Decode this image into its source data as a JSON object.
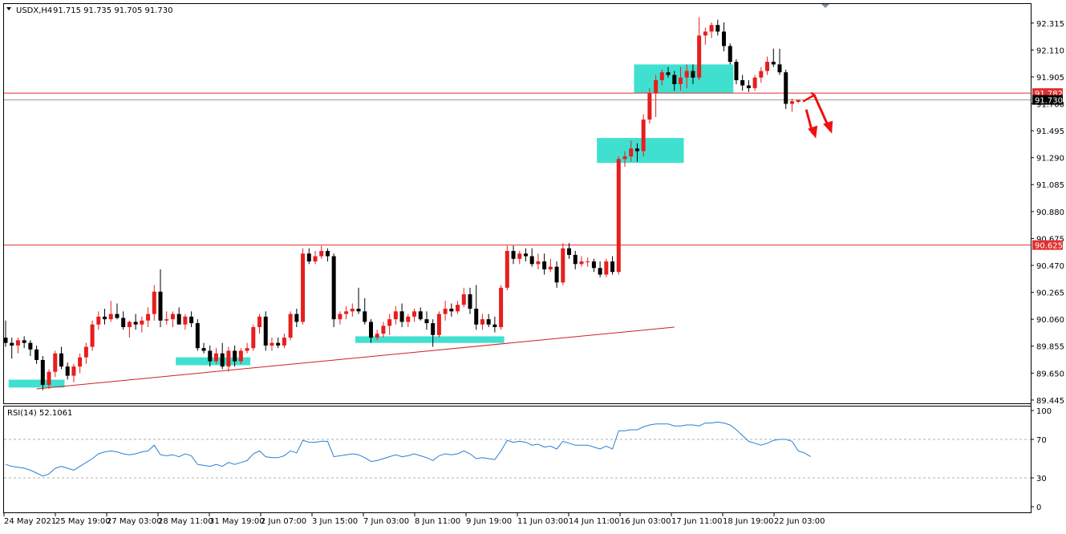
{
  "header": {
    "symbol_label": "USDX,H4",
    "ohlc_label": "91.715 91.735 91.705 91.730"
  },
  "rsi": {
    "label": "RSI(14) 52.1061",
    "levels": [
      70,
      30
    ],
    "ticks": [
      "100",
      "70",
      "30",
      "0"
    ],
    "color": "#2a7fd4",
    "level_color": "#b0b0b0"
  },
  "price_axis": {
    "ticks": [
      "92.315",
      "92.110",
      "91.905",
      "91.700",
      "91.495",
      "91.290",
      "91.085",
      "90.880",
      "90.675",
      "90.470",
      "90.265",
      "90.060",
      "89.855",
      "89.650",
      "89.445"
    ]
  },
  "time_axis": {
    "labels": [
      "24 May 2021",
      "25 May 19:00",
      "27 May 03:00",
      "28 May 11:00",
      "31 May 19:00",
      "2 Jun 07:00",
      "3 Jun 15:00",
      "7 Jun 03:00",
      "8 Jun 11:00",
      "9 Jun 19:00",
      "11 Jun 03:00",
      "14 Jun 11:00",
      "16 Jun 03:00",
      "17 Jun 11:00",
      "18 Jun 19:00",
      "22 Jun 03:00"
    ]
  },
  "levels": [
    {
      "price": 91.782,
      "label": "91.782",
      "color": "#e03030"
    },
    {
      "price": 90.625,
      "label": "90.625",
      "color": "#e03030"
    }
  ],
  "current_price": {
    "price": 91.73,
    "label": "91.730",
    "color": "#000000"
  },
  "colors": {
    "bull": "#e61e1e",
    "bear": "#000000",
    "zone": "#40e0d0",
    "trendline": "#cc2222",
    "arrow": "#ee1111"
  },
  "chart_data": {
    "type": "candlestick",
    "symbol": "USDX",
    "timeframe": "H4",
    "ylim": [
      89.42,
      92.46
    ],
    "rsi_ylim": [
      0,
      100
    ],
    "candles": [
      {
        "o": 89.92,
        "h": 90.05,
        "l": 89.85,
        "c": 89.88
      },
      {
        "o": 89.88,
        "h": 89.92,
        "l": 89.76,
        "c": 89.86
      },
      {
        "o": 89.86,
        "h": 89.92,
        "l": 89.8,
        "c": 89.9
      },
      {
        "o": 89.9,
        "h": 89.93,
        "l": 89.84,
        "c": 89.88
      },
      {
        "o": 89.88,
        "h": 89.9,
        "l": 89.78,
        "c": 89.83
      },
      {
        "o": 89.83,
        "h": 89.86,
        "l": 89.72,
        "c": 89.75
      },
      {
        "o": 89.75,
        "h": 89.78,
        "l": 89.52,
        "c": 89.56
      },
      {
        "o": 89.56,
        "h": 89.68,
        "l": 89.53,
        "c": 89.66
      },
      {
        "o": 89.66,
        "h": 89.82,
        "l": 89.62,
        "c": 89.8
      },
      {
        "o": 89.8,
        "h": 89.85,
        "l": 89.68,
        "c": 89.7
      },
      {
        "o": 89.7,
        "h": 89.73,
        "l": 89.6,
        "c": 89.63
      },
      {
        "o": 89.63,
        "h": 89.72,
        "l": 89.58,
        "c": 89.7
      },
      {
        "o": 89.7,
        "h": 89.8,
        "l": 89.65,
        "c": 89.77
      },
      {
        "o": 89.77,
        "h": 89.88,
        "l": 89.72,
        "c": 89.85
      },
      {
        "o": 89.85,
        "h": 90.05,
        "l": 89.82,
        "c": 90.02
      },
      {
        "o": 90.02,
        "h": 90.12,
        "l": 89.98,
        "c": 90.08
      },
      {
        "o": 90.08,
        "h": 90.14,
        "l": 90.02,
        "c": 90.06
      },
      {
        "o": 90.06,
        "h": 90.2,
        "l": 90.04,
        "c": 90.1
      },
      {
        "o": 90.1,
        "h": 90.18,
        "l": 90.06,
        "c": 90.07
      },
      {
        "o": 90.07,
        "h": 90.12,
        "l": 89.98,
        "c": 90.0
      },
      {
        "o": 90.0,
        "h": 90.05,
        "l": 89.92,
        "c": 90.04
      },
      {
        "o": 90.04,
        "h": 90.1,
        "l": 89.98,
        "c": 90.02
      },
      {
        "o": 90.02,
        "h": 90.08,
        "l": 89.96,
        "c": 90.05
      },
      {
        "o": 90.05,
        "h": 90.15,
        "l": 90.0,
        "c": 90.1
      },
      {
        "o": 90.1,
        "h": 90.32,
        "l": 90.05,
        "c": 90.27
      },
      {
        "o": 90.27,
        "h": 90.44,
        "l": 90.0,
        "c": 90.05
      },
      {
        "o": 90.05,
        "h": 90.12,
        "l": 90.02,
        "c": 90.06
      },
      {
        "o": 90.06,
        "h": 90.12,
        "l": 90.0,
        "c": 90.1
      },
      {
        "o": 90.1,
        "h": 90.15,
        "l": 90.04,
        "c": 90.02
      },
      {
        "o": 90.02,
        "h": 90.1,
        "l": 89.98,
        "c": 90.08
      },
      {
        "o": 90.08,
        "h": 90.12,
        "l": 90.0,
        "c": 90.03
      },
      {
        "o": 90.03,
        "h": 90.06,
        "l": 89.82,
        "c": 89.84
      },
      {
        "o": 89.84,
        "h": 89.88,
        "l": 89.8,
        "c": 89.82
      },
      {
        "o": 89.82,
        "h": 89.86,
        "l": 89.7,
        "c": 89.74
      },
      {
        "o": 89.74,
        "h": 89.84,
        "l": 89.72,
        "c": 89.8
      },
      {
        "o": 89.8,
        "h": 89.88,
        "l": 89.68,
        "c": 89.7
      },
      {
        "o": 89.7,
        "h": 89.85,
        "l": 89.66,
        "c": 89.82
      },
      {
        "o": 89.82,
        "h": 89.86,
        "l": 89.7,
        "c": 89.74
      },
      {
        "o": 89.74,
        "h": 89.84,
        "l": 89.72,
        "c": 89.82
      },
      {
        "o": 89.82,
        "h": 89.88,
        "l": 89.8,
        "c": 89.84
      },
      {
        "o": 89.84,
        "h": 90.02,
        "l": 89.82,
        "c": 90.0
      },
      {
        "o": 90.0,
        "h": 90.1,
        "l": 89.95,
        "c": 90.08
      },
      {
        "o": 90.08,
        "h": 90.12,
        "l": 89.82,
        "c": 89.86
      },
      {
        "o": 89.86,
        "h": 89.92,
        "l": 89.82,
        "c": 89.88
      },
      {
        "o": 89.88,
        "h": 89.92,
        "l": 89.84,
        "c": 89.86
      },
      {
        "o": 89.86,
        "h": 89.95,
        "l": 89.84,
        "c": 89.92
      },
      {
        "o": 89.92,
        "h": 90.12,
        "l": 89.9,
        "c": 90.1
      },
      {
        "o": 90.1,
        "h": 90.14,
        "l": 90.0,
        "c": 90.04
      },
      {
        "o": 90.04,
        "h": 90.6,
        "l": 90.02,
        "c": 90.56
      },
      {
        "o": 90.56,
        "h": 90.6,
        "l": 90.48,
        "c": 90.5
      },
      {
        "o": 90.5,
        "h": 90.58,
        "l": 90.48,
        "c": 90.54
      },
      {
        "o": 90.54,
        "h": 90.62,
        "l": 90.52,
        "c": 90.58
      },
      {
        "o": 90.58,
        "h": 90.6,
        "l": 90.5,
        "c": 90.54
      },
      {
        "o": 90.54,
        "h": 90.56,
        "l": 90.0,
        "c": 90.06
      },
      {
        "o": 90.06,
        "h": 90.12,
        "l": 90.02,
        "c": 90.1
      },
      {
        "o": 90.1,
        "h": 90.16,
        "l": 90.06,
        "c": 90.12
      },
      {
        "o": 90.12,
        "h": 90.18,
        "l": 90.08,
        "c": 90.14
      },
      {
        "o": 90.14,
        "h": 90.3,
        "l": 90.1,
        "c": 90.12
      },
      {
        "o": 90.12,
        "h": 90.22,
        "l": 90.02,
        "c": 90.04
      },
      {
        "o": 90.04,
        "h": 90.06,
        "l": 89.88,
        "c": 89.92
      },
      {
        "o": 89.92,
        "h": 89.98,
        "l": 89.9,
        "c": 89.95
      },
      {
        "o": 89.95,
        "h": 90.04,
        "l": 89.92,
        "c": 90.01
      },
      {
        "o": 90.01,
        "h": 90.1,
        "l": 89.94,
        "c": 90.06
      },
      {
        "o": 90.06,
        "h": 90.16,
        "l": 90.02,
        "c": 90.12
      },
      {
        "o": 90.12,
        "h": 90.18,
        "l": 90.0,
        "c": 90.04
      },
      {
        "o": 90.04,
        "h": 90.1,
        "l": 90.0,
        "c": 90.08
      },
      {
        "o": 90.08,
        "h": 90.14,
        "l": 90.04,
        "c": 90.12
      },
      {
        "o": 90.12,
        "h": 90.15,
        "l": 90.05,
        "c": 90.06
      },
      {
        "o": 90.06,
        "h": 90.12,
        "l": 89.98,
        "c": 90.03
      },
      {
        "o": 90.03,
        "h": 90.06,
        "l": 89.85,
        "c": 89.94
      },
      {
        "o": 89.94,
        "h": 90.12,
        "l": 89.92,
        "c": 90.1
      },
      {
        "o": 90.1,
        "h": 90.2,
        "l": 90.05,
        "c": 90.14
      },
      {
        "o": 90.14,
        "h": 90.18,
        "l": 90.08,
        "c": 90.12
      },
      {
        "o": 90.12,
        "h": 90.2,
        "l": 90.1,
        "c": 90.17
      },
      {
        "o": 90.17,
        "h": 90.3,
        "l": 90.15,
        "c": 90.25
      },
      {
        "o": 90.25,
        "h": 90.3,
        "l": 90.1,
        "c": 90.14
      },
      {
        "o": 90.14,
        "h": 90.32,
        "l": 89.98,
        "c": 90.02
      },
      {
        "o": 90.02,
        "h": 90.1,
        "l": 89.98,
        "c": 90.06
      },
      {
        "o": 90.06,
        "h": 90.1,
        "l": 90.0,
        "c": 90.02
      },
      {
        "o": 90.02,
        "h": 90.08,
        "l": 89.96,
        "c": 90.0
      },
      {
        "o": 90.0,
        "h": 90.32,
        "l": 89.98,
        "c": 90.3
      },
      {
        "o": 90.3,
        "h": 90.62,
        "l": 90.28,
        "c": 90.58
      },
      {
        "o": 90.58,
        "h": 90.62,
        "l": 90.48,
        "c": 90.52
      },
      {
        "o": 90.52,
        "h": 90.58,
        "l": 90.48,
        "c": 90.56
      },
      {
        "o": 90.56,
        "h": 90.6,
        "l": 90.5,
        "c": 90.54
      },
      {
        "o": 90.54,
        "h": 90.6,
        "l": 90.46,
        "c": 90.48
      },
      {
        "o": 90.48,
        "h": 90.56,
        "l": 90.44,
        "c": 90.5
      },
      {
        "o": 90.5,
        "h": 90.56,
        "l": 90.4,
        "c": 90.44
      },
      {
        "o": 90.44,
        "h": 90.52,
        "l": 90.42,
        "c": 90.46
      },
      {
        "o": 90.46,
        "h": 90.5,
        "l": 90.3,
        "c": 90.34
      },
      {
        "o": 90.34,
        "h": 90.64,
        "l": 90.32,
        "c": 90.6
      },
      {
        "o": 90.6,
        "h": 90.64,
        "l": 90.52,
        "c": 90.55
      },
      {
        "o": 90.55,
        "h": 90.58,
        "l": 90.44,
        "c": 90.48
      },
      {
        "o": 90.48,
        "h": 90.54,
        "l": 90.46,
        "c": 90.5
      },
      {
        "o": 90.5,
        "h": 90.53,
        "l": 90.46,
        "c": 90.5
      },
      {
        "o": 90.5,
        "h": 90.52,
        "l": 90.42,
        "c": 90.45
      },
      {
        "o": 90.45,
        "h": 90.5,
        "l": 90.38,
        "c": 90.4
      },
      {
        "o": 90.4,
        "h": 90.52,
        "l": 90.38,
        "c": 90.5
      },
      {
        "o": 90.5,
        "h": 90.54,
        "l": 90.4,
        "c": 90.42
      },
      {
        "o": 90.42,
        "h": 91.3,
        "l": 90.4,
        "c": 91.28
      },
      {
        "o": 91.28,
        "h": 91.34,
        "l": 91.22,
        "c": 91.3
      },
      {
        "o": 91.3,
        "h": 91.42,
        "l": 91.26,
        "c": 91.36
      },
      {
        "o": 91.36,
        "h": 91.4,
        "l": 91.26,
        "c": 91.34
      },
      {
        "o": 91.34,
        "h": 91.62,
        "l": 91.3,
        "c": 91.58
      },
      {
        "o": 91.58,
        "h": 91.82,
        "l": 91.55,
        "c": 91.78
      },
      {
        "o": 91.78,
        "h": 91.92,
        "l": 91.6,
        "c": 91.88
      },
      {
        "o": 91.88,
        "h": 91.96,
        "l": 91.84,
        "c": 91.94
      },
      {
        "o": 91.94,
        "h": 91.98,
        "l": 91.9,
        "c": 91.92
      },
      {
        "o": 91.92,
        "h": 91.95,
        "l": 91.8,
        "c": 91.85
      },
      {
        "o": 91.85,
        "h": 91.98,
        "l": 91.8,
        "c": 91.9
      },
      {
        "o": 91.9,
        "h": 92.0,
        "l": 91.82,
        "c": 91.95
      },
      {
        "o": 91.95,
        "h": 92.0,
        "l": 91.85,
        "c": 91.9
      },
      {
        "o": 91.9,
        "h": 92.36,
        "l": 91.88,
        "c": 92.22
      },
      {
        "o": 92.22,
        "h": 92.28,
        "l": 92.15,
        "c": 92.25
      },
      {
        "o": 92.25,
        "h": 92.32,
        "l": 92.2,
        "c": 92.3
      },
      {
        "o": 92.3,
        "h": 92.34,
        "l": 92.22,
        "c": 92.25
      },
      {
        "o": 92.25,
        "h": 92.32,
        "l": 92.1,
        "c": 92.14
      },
      {
        "o": 92.14,
        "h": 92.16,
        "l": 92.0,
        "c": 92.02
      },
      {
        "o": 92.02,
        "h": 92.04,
        "l": 91.85,
        "c": 91.88
      },
      {
        "o": 91.88,
        "h": 91.92,
        "l": 91.8,
        "c": 91.84
      },
      {
        "o": 91.84,
        "h": 91.88,
        "l": 91.79,
        "c": 91.82
      },
      {
        "o": 91.82,
        "h": 91.92,
        "l": 91.8,
        "c": 91.9
      },
      {
        "o": 91.9,
        "h": 91.98,
        "l": 91.86,
        "c": 91.95
      },
      {
        "o": 91.95,
        "h": 92.06,
        "l": 91.92,
        "c": 92.02
      },
      {
        "o": 92.02,
        "h": 92.12,
        "l": 91.98,
        "c": 92.0
      },
      {
        "o": 92.0,
        "h": 92.12,
        "l": 91.92,
        "c": 91.94
      },
      {
        "o": 91.94,
        "h": 91.96,
        "l": 91.66,
        "c": 91.7
      },
      {
        "o": 91.7,
        "h": 91.74,
        "l": 91.64,
        "c": 91.72
      },
      {
        "o": 91.715,
        "h": 91.735,
        "l": 91.705,
        "c": 91.73
      }
    ],
    "rsi_values": [
      44,
      42,
      41,
      40,
      38,
      35,
      32,
      34,
      40,
      42,
      40,
      38,
      42,
      46,
      50,
      55,
      57,
      58,
      57,
      55,
      54,
      55,
      57,
      58,
      64,
      54,
      53,
      54,
      52,
      55,
      53,
      44,
      43,
      42,
      44,
      42,
      46,
      44,
      46,
      48,
      55,
      58,
      52,
      51,
      51,
      53,
      58,
      56,
      69,
      67,
      67,
      68,
      68,
      52,
      53,
      54,
      55,
      54,
      51,
      47,
      48,
      50,
      52,
      54,
      52,
      53,
      55,
      53,
      51,
      48,
      53,
      55,
      54,
      55,
      58,
      55,
      50,
      51,
      50,
      49,
      58,
      69,
      67,
      68,
      67,
      64,
      65,
      62,
      63,
      60,
      68,
      66,
      64,
      64,
      64,
      62,
      60,
      63,
      60,
      79,
      79,
      80,
      80,
      83,
      85,
      86,
      86,
      86,
      84,
      84,
      85,
      85,
      84,
      87,
      87,
      88,
      87,
      85,
      80,
      74,
      68,
      66,
      64,
      66,
      69,
      70,
      70,
      68,
      58,
      56,
      52
    ],
    "zones": [
      {
        "from": 1,
        "to": 9,
        "low": 89.54,
        "high": 89.6
      },
      {
        "from": 28,
        "to": 39,
        "low": 89.71,
        "high": 89.77
      },
      {
        "from": 57,
        "to": 80,
        "low": 89.88,
        "high": 89.93
      },
      {
        "from": 96,
        "to": 109,
        "low": 91.25,
        "high": 91.44
      },
      {
        "from": 102,
        "to": 117,
        "low": 91.78,
        "high": 92.0
      }
    ],
    "trendline": {
      "from": 5,
      "from_price": 89.53,
      "to": 108,
      "to_price": 90.0
    }
  }
}
